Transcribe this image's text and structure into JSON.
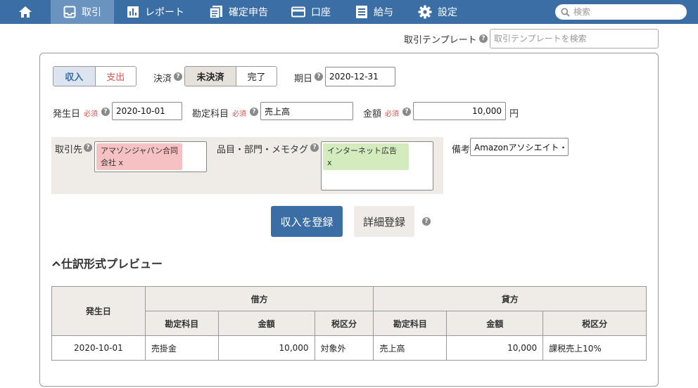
{
  "nav": {
    "items": [
      {
        "label": "",
        "icon": "home-icon"
      },
      {
        "label": "取引",
        "icon": "inbox-icon",
        "active": true
      },
      {
        "label": "レポート",
        "icon": "bar-chart-icon"
      },
      {
        "label": "確定申告",
        "icon": "document-icon"
      },
      {
        "label": "口座",
        "icon": "credit-card-icon"
      },
      {
        "label": "給与",
        "icon": "list-icon"
      },
      {
        "label": "設定",
        "icon": "gear-icon"
      }
    ],
    "search_placeholder": "検索"
  },
  "template": {
    "label": "取引テンプレート",
    "placeholder": "取引テンプレートを検索"
  },
  "form": {
    "type_income": "収入",
    "type_expense": "支出",
    "settlement_label": "決済",
    "unsettled": "未決済",
    "settled": "完了",
    "due_label": "期日",
    "due_value": "2020-12-31",
    "date_label": "発生日",
    "required": "必須",
    "date_value": "2020-10-01",
    "account_label": "勘定科目",
    "account_value": "売上高",
    "amount_label": "金額",
    "amount_value": "10,000",
    "yen": "円",
    "partner_label": "取引先",
    "partner_tag_line1": "アマゾンジャパン合同",
    "partner_tag_line2": "会社 x",
    "items_label": "品目・部門・メモタグ",
    "items_tag_line1": "インターネット広告",
    "items_tag_line2": "x",
    "memo_label": "備考",
    "memo_value": "Amazonアソシエイト・"
  },
  "buttons": {
    "register": "収入を登録",
    "detail": "詳細登録"
  },
  "preview": {
    "title": "仕訳形式プレビュー",
    "headers": {
      "date": "発生日",
      "debit": "借方",
      "credit": "貸方",
      "account": "勘定科目",
      "amount": "金額",
      "tax": "税区分"
    },
    "row": {
      "date": "2020-10-01",
      "debit_account": "売掛金",
      "debit_amount": "10,000",
      "debit_tax": "対象外",
      "credit_account": "売上高",
      "credit_amount": "10,000",
      "credit_tax": "課税売上10%"
    }
  },
  "colors": {
    "nav_bg": "#3a6ea5",
    "nav_active": "#6b93c0",
    "partner_tag": "#f5c1c3",
    "items_tag": "#d3ebbd",
    "expense_text": "#d9534f"
  }
}
